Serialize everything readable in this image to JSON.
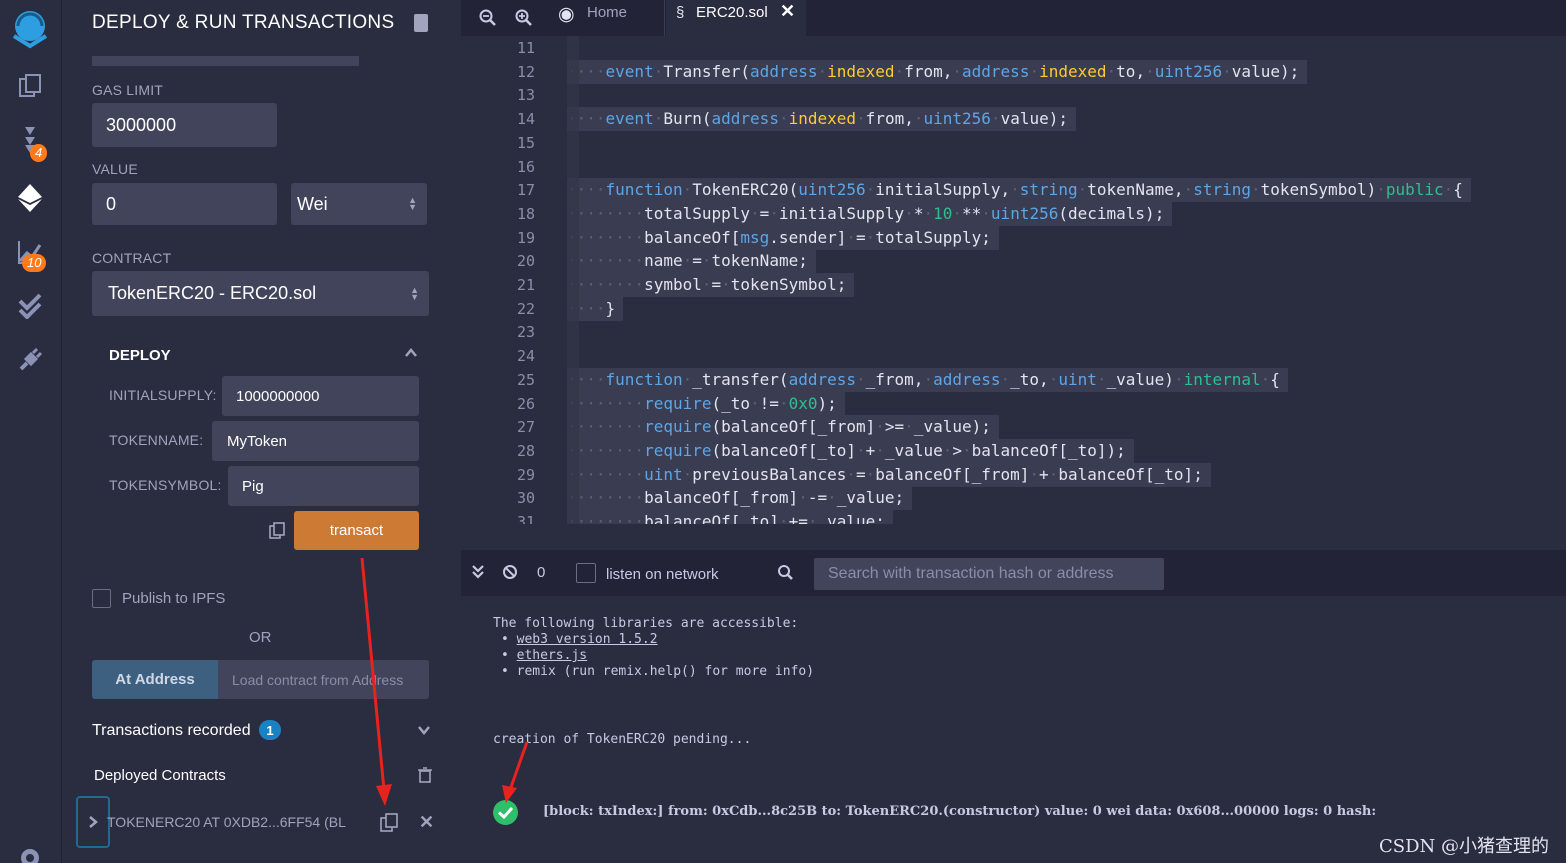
{
  "rail": {
    "badges": {
      "compile": "4",
      "analysis": "10"
    }
  },
  "panel": {
    "title": "DEPLOY & RUN TRANSACTIONS",
    "gas_limit_label": "GAS LIMIT",
    "gas_limit_value": "3000000",
    "value_label": "VALUE",
    "value_value": "0",
    "value_unit": "Wei",
    "contract_label": "CONTRACT",
    "contract_value": "TokenERC20 - ERC20.sol",
    "deploy_label": "DEPLOY",
    "params": [
      {
        "label": "INITIALSUPPLY:",
        "value": "1000000000"
      },
      {
        "label": "TOKENNAME:",
        "value": "MyToken"
      },
      {
        "label": "TOKENSYMBOL:",
        "value": "Pig"
      }
    ],
    "transact_label": "transact",
    "publish_label": "Publish to IPFS",
    "or_label": "OR",
    "at_address_label": "At Address",
    "load_contract_placeholder": "Load contract from Address",
    "tx_recorded_label": "Transactions recorded",
    "tx_recorded_count": "1",
    "deployed_label": "Deployed Contracts",
    "deployed_instance": "TOKENERC20 AT 0XDB2...6FF54 (BL"
  },
  "tabs": {
    "home": "Home",
    "file": "ERC20.sol"
  },
  "editor": {
    "lines": [
      {
        "n": "11",
        "html": ""
      },
      {
        "n": "12",
        "html": "<span class='dot'>····</span><span class='kw'>event</span><span class='dot'>·</span>Transfer(<span class='kw'>address</span><span class='dot'>·</span><span class='kw2'>indexed</span><span class='dot'>·</span>from,<span class='dot'>·</span><span class='kw'>address</span><span class='dot'>·</span><span class='kw2'>indexed</span><span class='dot'>·</span>to,<span class='dot'>·</span><span class='kw'>uint256</span><span class='dot'>·</span>value);"
      },
      {
        "n": "13",
        "html": ""
      },
      {
        "n": "14",
        "html": "<span class='dot'>····</span><span class='kw'>event</span><span class='dot'>·</span>Burn(<span class='kw'>address</span><span class='dot'>·</span><span class='kw2'>indexed</span><span class='dot'>·</span>from,<span class='dot'>·</span><span class='kw'>uint256</span><span class='dot'>·</span>value);"
      },
      {
        "n": "15",
        "html": ""
      },
      {
        "n": "16",
        "html": ""
      },
      {
        "n": "17",
        "html": "<span class='dot'>····</span><span class='kw'>function</span><span class='dot'>·</span>TokenERC20(<span class='kw'>uint256</span><span class='dot'>·</span>initialSupply,<span class='dot'>·</span><span class='kw'>string</span><span class='dot'>·</span>tokenName,<span class='dot'>·</span><span class='kw'>string</span><span class='dot'>·</span>tokenSymbol)<span class='dot'>·</span><span class='kw3'>public</span><span class='dot'>·</span>{"
      },
      {
        "n": "18",
        "html": "<span class='dot'>········</span>totalSupply<span class='dot'>·</span>=<span class='dot'>·</span>initialSupply<span class='dot'>·</span>*<span class='dot'>·</span><span class='num'>10</span><span class='dot'>·</span>**<span class='dot'>·</span><span class='kw'>uint256</span>(decimals);"
      },
      {
        "n": "19",
        "html": "<span class='dot'>········</span>balanceOf[<span class='kw'>msg</span>.sender]<span class='dot'>·</span>=<span class='dot'>·</span>totalSupply;"
      },
      {
        "n": "20",
        "html": "<span class='dot'>········</span>name<span class='dot'>·</span>=<span class='dot'>·</span>tokenName;"
      },
      {
        "n": "21",
        "html": "<span class='dot'>········</span>symbol<span class='dot'>·</span>=<span class='dot'>·</span>tokenSymbol;"
      },
      {
        "n": "22",
        "html": "<span class='dot'>····</span>}"
      },
      {
        "n": "23",
        "html": ""
      },
      {
        "n": "24",
        "html": ""
      },
      {
        "n": "25",
        "html": "<span class='dot'>····</span><span class='kw'>function</span><span class='dot'>·</span>_transfer(<span class='kw'>address</span><span class='dot'>·</span>_from,<span class='dot'>·</span><span class='kw'>address</span><span class='dot'>·</span>_to,<span class='dot'>·</span><span class='kw'>uint</span><span class='dot'>·</span>_value)<span class='dot'>·</span><span class='kw3'>internal</span><span class='dot'>·</span>{"
      },
      {
        "n": "26",
        "html": "<span class='dot'>········</span><span class='kw'>require</span>(_to<span class='dot'>·</span>!=<span class='dot'>·</span><span class='num'>0x0</span>);"
      },
      {
        "n": "27",
        "html": "<span class='dot'>········</span><span class='kw'>require</span>(balanceOf[_from]<span class='dot'>·</span>>=<span class='dot'>·</span>_value);"
      },
      {
        "n": "28",
        "html": "<span class='dot'>········</span><span class='kw'>require</span>(balanceOf[_to]<span class='dot'>·</span>+<span class='dot'>·</span>_value<span class='dot'>·</span>><span class='dot'>·</span>balanceOf[_to]);"
      },
      {
        "n": "29",
        "html": "<span class='dot'>········</span><span class='kw'>uint</span><span class='dot'>·</span>previousBalances<span class='dot'>·</span>=<span class='dot'>·</span>balanceOf[_from]<span class='dot'>·</span>+<span class='dot'>·</span>balanceOf[_to];"
      },
      {
        "n": "30",
        "html": "<span class='dot'>········</span>balanceOf[_from]<span class='dot'>·</span>-=<span class='dot'>·</span>_value;"
      },
      {
        "n": "31",
        "html": "<span class='dot'>········</span>balanceOf[_to]<span class='dot'>·</span>+=<span class='dot'>·</span>_value;"
      }
    ]
  },
  "termbar": {
    "count": "0",
    "listen_label": "listen on network",
    "search_placeholder": "Search with transaction hash or address"
  },
  "terminal": {
    "intro": "The following libraries are accessible:",
    "libs": [
      "web3 version 1.5.2",
      "ethers.js",
      "remix (run remix.help() for more info)"
    ],
    "pending": "creation of TokenERC20 pending...",
    "tx_line": "[block: txIndex:] from: 0xCdb...8c25B to: TokenERC20.(constructor) value: 0 wei data: 0x608...00000 logs: 0 hash:",
    "watermark": "CSDN @小猪查理的"
  }
}
